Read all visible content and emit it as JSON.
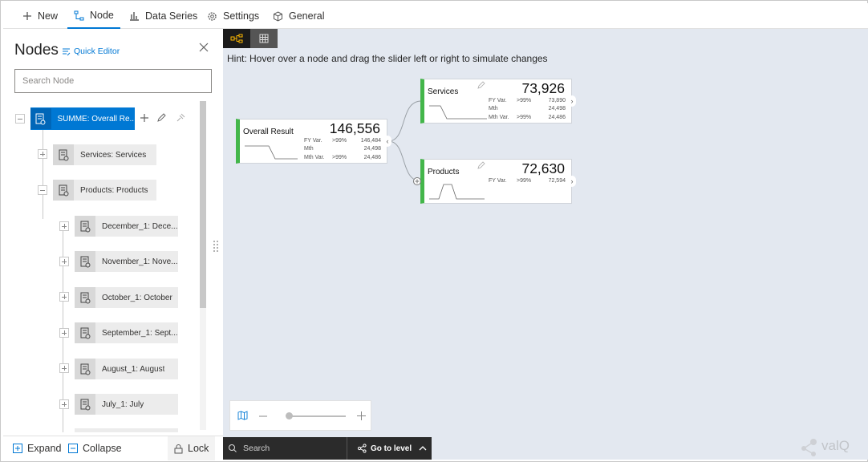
{
  "toolbar": {
    "tabs": [
      {
        "label": "New",
        "icon": "plus-icon"
      },
      {
        "label": "Node",
        "icon": "node-icon",
        "active": true
      },
      {
        "label": "Data Series",
        "icon": "bar-chart-icon"
      },
      {
        "label": "Settings",
        "icon": "gear-icon"
      },
      {
        "label": "General",
        "icon": "cube-icon"
      }
    ]
  },
  "panel": {
    "title": "Nodes",
    "quick_editor": "Quick Editor",
    "search_placeholder": "Search Node",
    "tree": [
      {
        "label": "SUMME: Overall Re...",
        "level": 0,
        "expanded": true,
        "selected": true
      },
      {
        "label": "Services: Services",
        "level": 1,
        "expanded": false
      },
      {
        "label": "Products: Products",
        "level": 1,
        "expanded": true
      },
      {
        "label": "December_1: Dece...",
        "level": 2,
        "expanded": false
      },
      {
        "label": "November_1: Nove...",
        "level": 2,
        "expanded": false
      },
      {
        "label": "October_1: October",
        "level": 2,
        "expanded": false
      },
      {
        "label": "September_1: Sept...",
        "level": 2,
        "expanded": false
      },
      {
        "label": "August_1: August",
        "level": 2,
        "expanded": false
      },
      {
        "label": "July_1: July",
        "level": 2,
        "expanded": false
      }
    ],
    "footer": {
      "expand": "Expand",
      "collapse": "Collapse",
      "lock": "Lock"
    }
  },
  "canvas": {
    "hint": "Hint: Hover over a node and drag the slider left or right to simulate changes",
    "nodes": {
      "overall": {
        "name": "Overall Result",
        "value": "146,556",
        "metrics": [
          {
            "label": "FY Var.",
            "pct": ">99%",
            "value": "146,484"
          },
          {
            "label": "Mth",
            "pct": "",
            "value": "24,498"
          },
          {
            "label": "Mth Var.",
            "pct": ">99%",
            "value": "24,486"
          }
        ]
      },
      "services": {
        "name": "Services",
        "value": "73,926",
        "metrics": [
          {
            "label": "FY Var.",
            "pct": ">99%",
            "value": "73,890"
          },
          {
            "label": "Mth",
            "pct": "",
            "value": "24,498"
          },
          {
            "label": "Mth Var.",
            "pct": ">99%",
            "value": "24,486"
          }
        ]
      },
      "products": {
        "name": "Products",
        "value": "72,630",
        "metrics": [
          {
            "label": "FY Var.",
            "pct": ">99%",
            "value": "72,594"
          }
        ]
      }
    },
    "search_placeholder": "Search",
    "goto_level": "Go to level",
    "logo": "valQ"
  },
  "colors": {
    "accent": "#0078d4",
    "node_bar": "#43b64a",
    "canvas_bg": "#e3e8f0",
    "toggle_active": "#ffb900"
  }
}
